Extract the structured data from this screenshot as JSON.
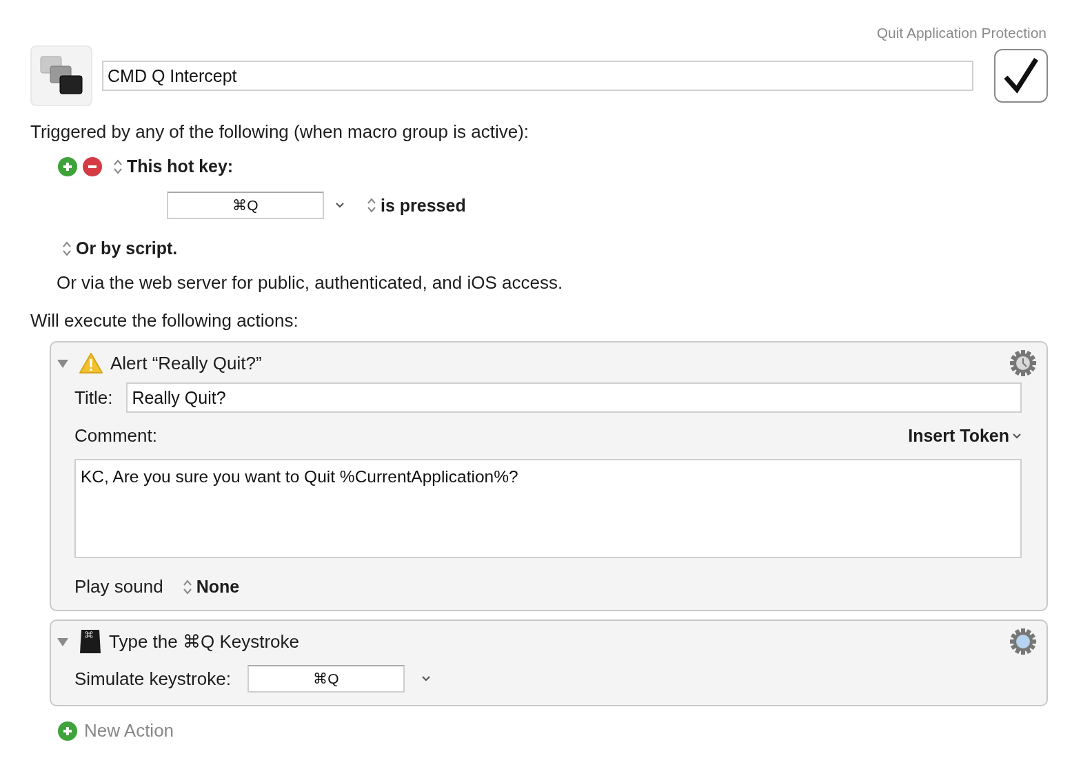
{
  "group_name": "Quit Application Protection",
  "macro": {
    "name": "CMD Q Intercept",
    "enabled": true
  },
  "triggers_heading": "Triggered by any of the following (when macro group is active):",
  "trigger": {
    "type": "This hot key:",
    "hotkey": "⌘Q",
    "condition": "is pressed"
  },
  "script_trigger": "Or by script.",
  "web_server_note": "Or via the web server for public, authenticated, and iOS access.",
  "actions_heading": "Will execute the following actions:",
  "actions": [
    {
      "kind": "alert",
      "expanded": true,
      "title": "Alert “Really Quit?”",
      "fields": {
        "title_label": "Title:",
        "title_value": "Really Quit?",
        "comment_label": "Comment:",
        "insert_token": "Insert Token",
        "comment_value": "KC, Are you sure you want to Quit %CurrentApplication%?",
        "sound_label": "Play sound",
        "sound_value": "None"
      }
    },
    {
      "kind": "keystroke",
      "expanded": true,
      "title": "Type the ⌘Q Keystroke",
      "fields": {
        "keystroke_label": "Simulate keystroke:",
        "keystroke_value": "⌘Q"
      }
    }
  ],
  "new_action": "New Action"
}
